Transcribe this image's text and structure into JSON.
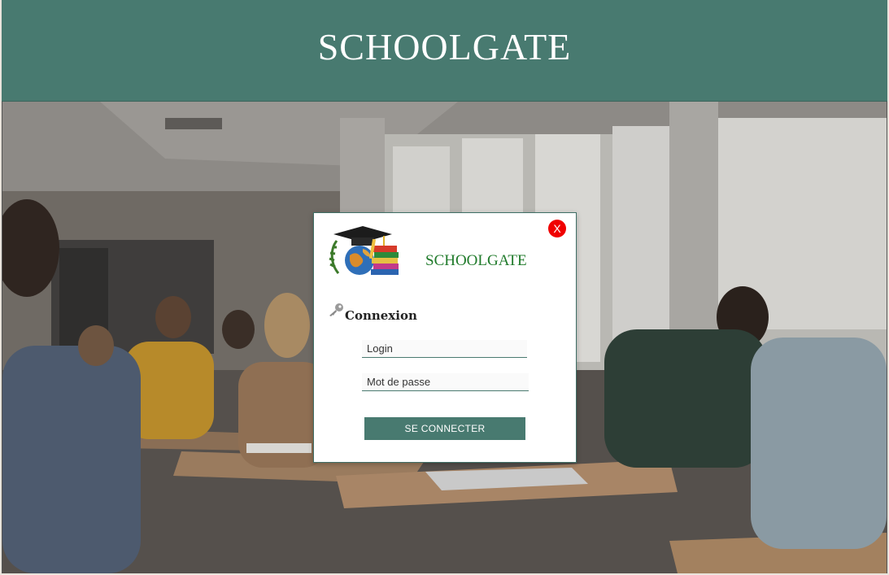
{
  "header": {
    "title": "SCHOOLGATE"
  },
  "background": {
    "description_icon": "classroom-exam-photo"
  },
  "modal": {
    "brand": "SCHOOLGATE",
    "close_label": "X",
    "section_title": "Connexion",
    "login": {
      "placeholder": "Login",
      "value": ""
    },
    "password": {
      "placeholder": "Mot de passe",
      "value": ""
    },
    "submit_label": "SE CONNECTER"
  },
  "colors": {
    "primary": "#487a70",
    "brand_green": "#1f7a2a",
    "close_red": "#f00000"
  },
  "icons": [
    "graduation-logo-icon",
    "key-icon",
    "close-icon"
  ]
}
